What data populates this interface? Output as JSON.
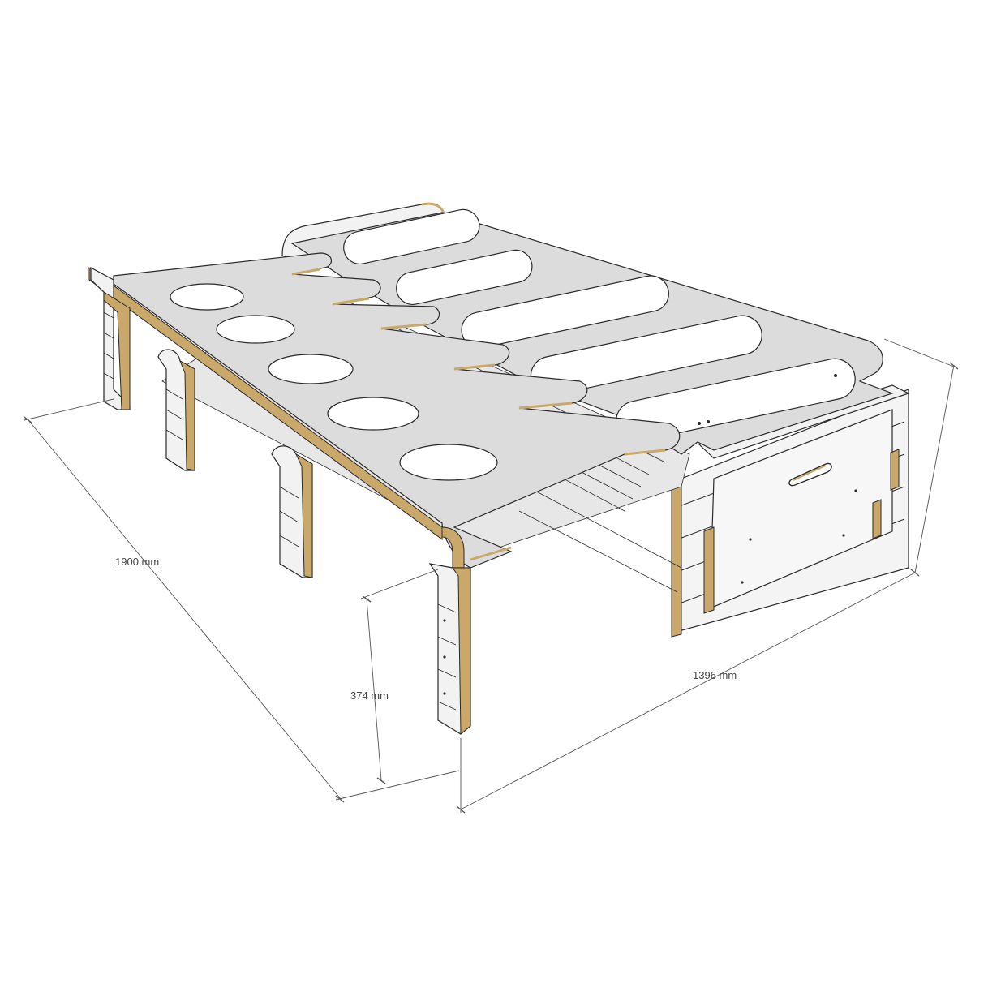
{
  "dimensions": {
    "length": "1900 mm",
    "width": "1396 mm",
    "height": "374 mm"
  },
  "colors": {
    "panel": "#dcdcdc",
    "panel_dark": "#c9c9c9",
    "plywood_edge": "#c9a86a",
    "line": "#2a2a2a",
    "white": "#ffffff",
    "dimension_line": "#555555"
  }
}
